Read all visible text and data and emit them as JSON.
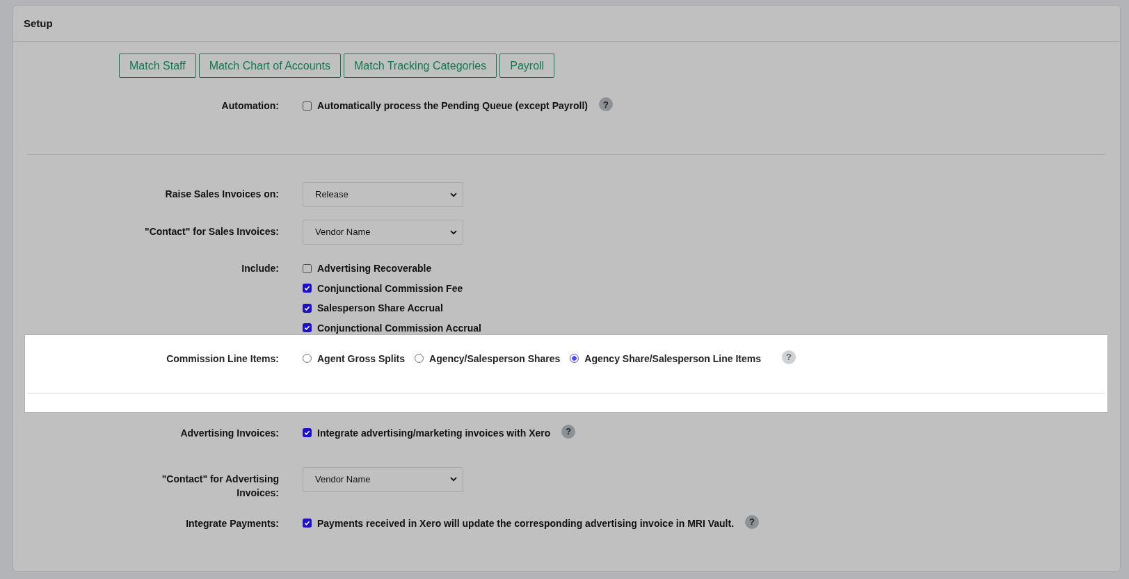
{
  "card": {
    "title": "Setup"
  },
  "buttons": [
    "Match Staff",
    "Match Chart of Accounts",
    "Match Tracking Categories",
    "Payroll"
  ],
  "sections": [
    {
      "highlighted": false,
      "divider_below": true,
      "rows": [
        {
          "kind": "checkbox",
          "label": "Automation:",
          "help": "?",
          "options": [
            {
              "text": "Automatically process the Pending Queue (except Payroll)",
              "checked": false
            }
          ]
        }
      ]
    },
    {
      "highlighted": false,
      "divider_below": false,
      "rows": [
        {
          "kind": "select",
          "label": "Raise Sales Invoices on:",
          "value": "Release"
        },
        {
          "kind": "select",
          "label": "\"Contact\" for Sales Invoices:",
          "value": "Vendor Name"
        },
        {
          "kind": "checkbox",
          "label": "Include:",
          "options": [
            {
              "text": "Advertising Recoverable",
              "checked": false
            },
            {
              "text": "Conjunctional Commission Fee",
              "checked": true
            },
            {
              "text": "Salesperson Share Accrual",
              "checked": true
            },
            {
              "text": "Conjunctional Commission Accrual",
              "checked": true
            }
          ]
        }
      ]
    },
    {
      "highlighted": true,
      "divider_below": true,
      "rows": [
        {
          "kind": "radio",
          "label": "Commission Line Items:",
          "help": "?",
          "options": [
            {
              "text": "Agent Gross Splits",
              "selected": false
            },
            {
              "text": "Agency/Salesperson Shares",
              "selected": false
            },
            {
              "text": "Agency Share/Salesperson Line Items",
              "selected": true
            }
          ]
        }
      ]
    },
    {
      "highlighted": false,
      "divider_below": false,
      "rows": [
        {
          "kind": "checkbox",
          "label": "Advertising Invoices:",
          "help": "?",
          "options": [
            {
              "text": "Integrate advertising/marketing invoices with Xero",
              "checked": true
            }
          ]
        },
        {
          "kind": "select",
          "label": "\"Contact\" for Advertising Invoices:",
          "value": "Vendor Name"
        },
        {
          "kind": "checkbox",
          "label": "Integrate Payments:",
          "help": "?",
          "options": [
            {
              "text": "Payments received in Xero will update the corresponding advertising invoice in MRI Vault.",
              "checked": true
            }
          ]
        }
      ]
    }
  ]
}
